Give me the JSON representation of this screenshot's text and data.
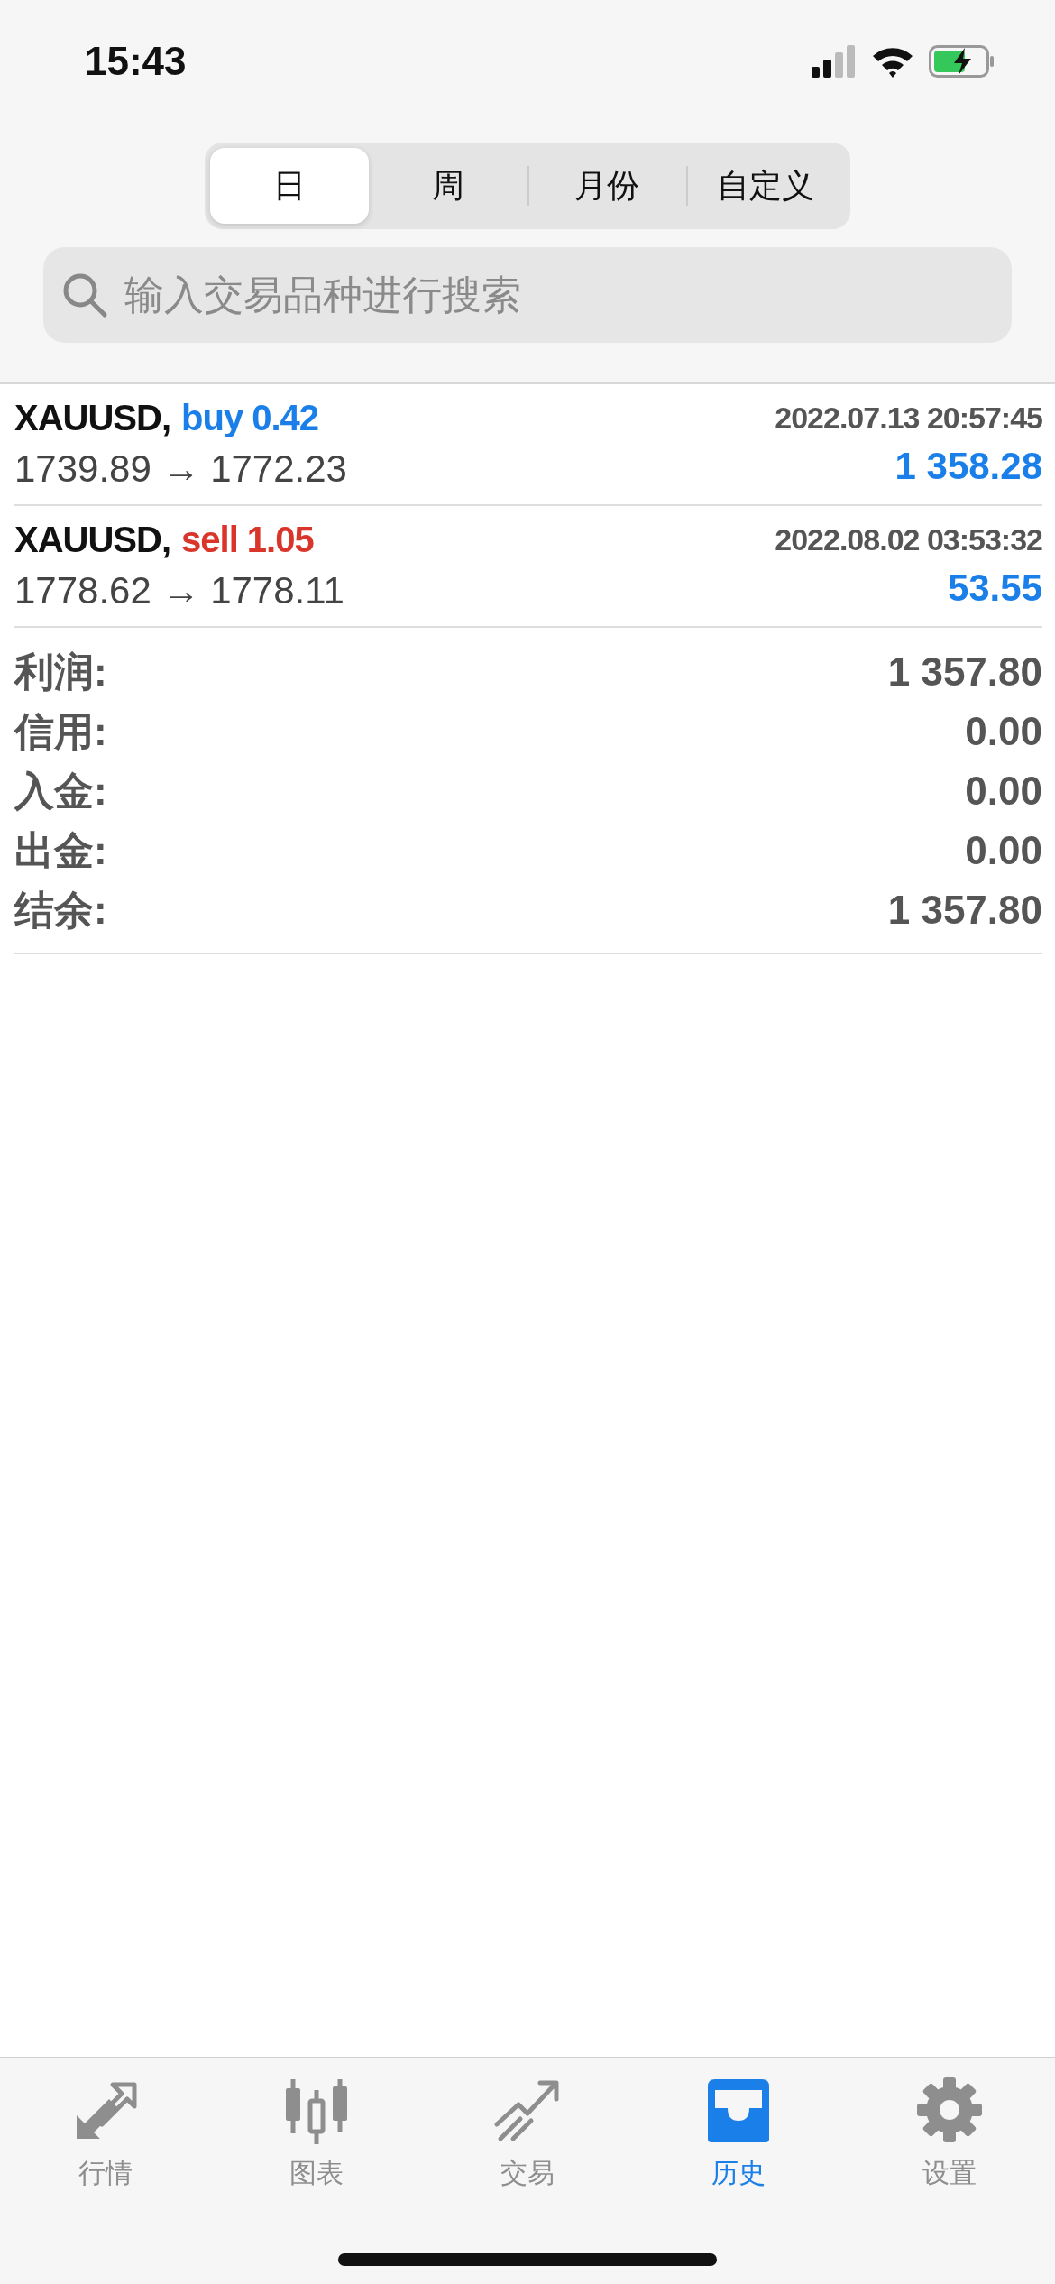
{
  "status_bar": {
    "time": "15:43"
  },
  "period_tabs": [
    {
      "label": "日",
      "selected": true
    },
    {
      "label": "周",
      "selected": false
    },
    {
      "label": "月份",
      "selected": false
    },
    {
      "label": "自定义",
      "selected": false
    }
  ],
  "search": {
    "placeholder": "输入交易品种进行搜索"
  },
  "deals": [
    {
      "symbol": "XAUUSD,",
      "kind": "buy",
      "order": "buy 0.42",
      "time": "2022.07.13 20:57:45",
      "prices": "1739.89 → 1772.23",
      "profit": "1 358.28"
    },
    {
      "symbol": "XAUUSD,",
      "kind": "sell",
      "order": "sell 1.05",
      "time": "2022.08.02 03:53:32",
      "prices": "1778.62 → 1778.11",
      "profit": "53.55"
    }
  ],
  "summary": [
    {
      "label": "利润:",
      "value": "1 357.80"
    },
    {
      "label": "信用:",
      "value": "0.00"
    },
    {
      "label": "入金:",
      "value": "0.00"
    },
    {
      "label": "出金:",
      "value": "0.00"
    },
    {
      "label": "结余:",
      "value": "1 357.80"
    }
  ],
  "tab_bar": [
    {
      "kind": "quotes",
      "label": "行情",
      "selected": false
    },
    {
      "kind": "chart",
      "label": "图表",
      "selected": false
    },
    {
      "kind": "trade",
      "label": "交易",
      "selected": false
    },
    {
      "kind": "history",
      "label": "历史",
      "selected": true
    },
    {
      "kind": "settings",
      "label": "设置",
      "selected": false
    }
  ]
}
